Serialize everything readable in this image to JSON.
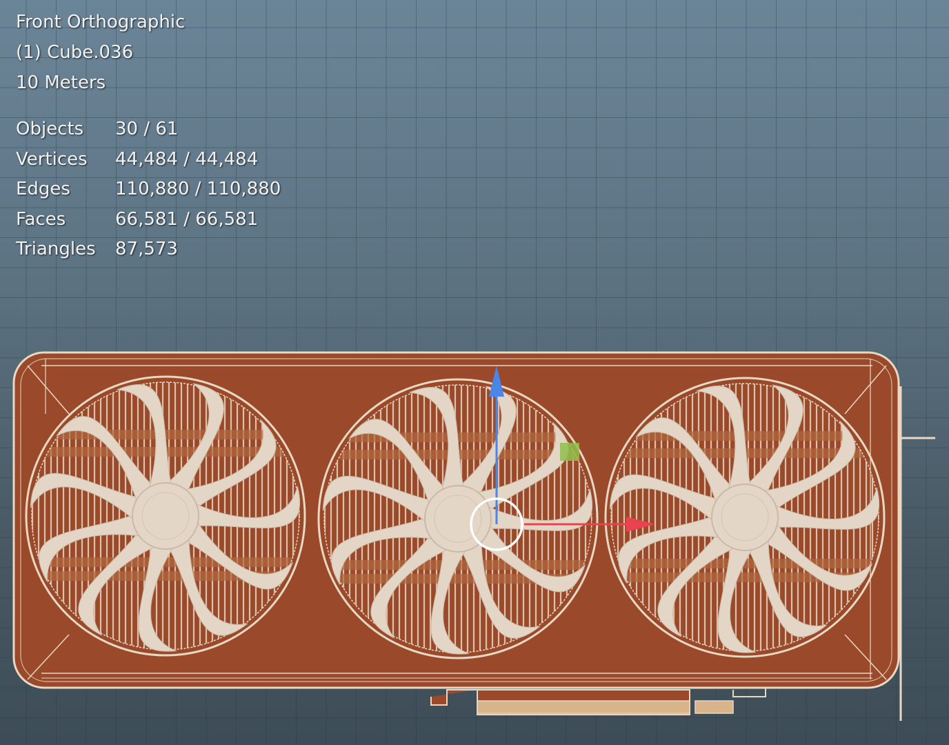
{
  "viewport": {
    "view_name": "Front Orthographic",
    "active_object": "(1) Cube.036",
    "scale": "10 Meters"
  },
  "statistics": [
    {
      "label": "Objects",
      "value": "30 / 61"
    },
    {
      "label": "Vertices",
      "value": "44,484 / 44,484"
    },
    {
      "label": "Edges",
      "value": "110,880 / 110,880"
    },
    {
      "label": "Faces",
      "value": "66,581 / 66,581"
    },
    {
      "label": "Triangles",
      "value": "87,573"
    }
  ],
  "scene": {
    "object": "graphics-card-model",
    "fan_count": 3,
    "blades_per_fan": 11,
    "colors": {
      "shroud": "#9a4a2a",
      "wire": "#e8d8c4",
      "blade": "#e3d6c6",
      "gizmo_x": "#e8434f",
      "gizmo_z": "#4a86e8",
      "gizmo_plane": "#8fc04a"
    }
  }
}
